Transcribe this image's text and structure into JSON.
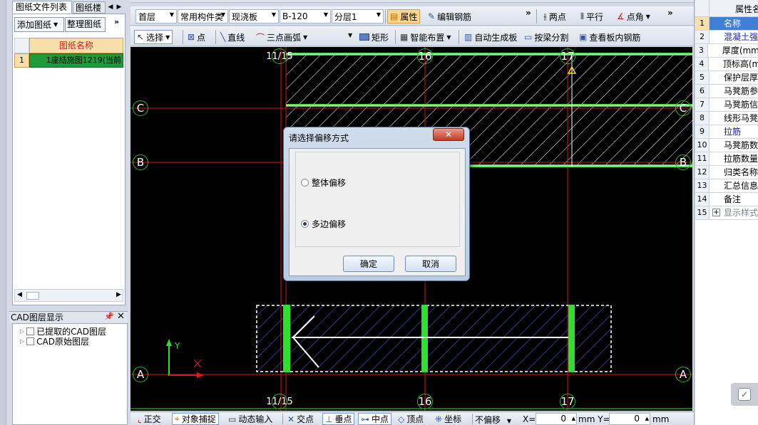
{
  "left_panel": {
    "tabs": [
      "图纸文件列表",
      "图纸楼"
    ],
    "buttons": {
      "add": "添加图纸",
      "organize": "整理图纸"
    },
    "column_header": "图纸名称",
    "rows": [
      {
        "num": "1",
        "name": "1座结施图1219(当前"
      }
    ]
  },
  "cad_layers": {
    "title": "CAD图层显示",
    "items": [
      "已提取的CAD图层",
      "CAD原始图层"
    ]
  },
  "toolbar1": {
    "floor": "首层",
    "component_type": "常用构件类",
    "slab_type": "现浇板",
    "component": "B-120",
    "layer": "分层1",
    "property_label": "属性",
    "edit_rebar_label": "编辑钢筋",
    "two_points_label": "两点",
    "parallel_label": "平行",
    "point_angle_label": "点角"
  },
  "toolbar2": {
    "select_label": "选择",
    "point_label": "点",
    "line_label": "直线",
    "arc_label": "三点画弧",
    "rect_label": "矩形",
    "smart_layout_label": "智能布置",
    "auto_slab_label": "自动生成板",
    "split_by_beam_label": "按梁分割",
    "view_rebar_label": "查看板内钢筋"
  },
  "canvas": {
    "grid_labels_top": [
      "11/15",
      "16",
      "17"
    ],
    "grid_labels_bottom": [
      "11/15",
      "16",
      "17"
    ],
    "row_labels": [
      "C",
      "B",
      "A"
    ],
    "axis_y": "Y",
    "axis_x": "X"
  },
  "dialog": {
    "title": "请选择偏移方式",
    "option_whole": "整体偏移",
    "option_multi": "多边偏移",
    "selected": "多边偏移",
    "ok": "确定",
    "cancel": "取消"
  },
  "properties": {
    "header": "属性名",
    "rows": [
      {
        "num": "1",
        "label": "名称",
        "color": "#1a1aa0",
        "selected": true
      },
      {
        "num": "2",
        "label": "混凝土强",
        "color": "#1a1aa0"
      },
      {
        "num": "3",
        "label": "厚度(mm)",
        "color": "#000000"
      },
      {
        "num": "4",
        "label": "顶标高(m",
        "color": "#000000"
      },
      {
        "num": "5",
        "label": "保护层厚",
        "color": "#000000"
      },
      {
        "num": "6",
        "label": "马凳筋参",
        "color": "#000000"
      },
      {
        "num": "7",
        "label": "马凳筋信",
        "color": "#000000"
      },
      {
        "num": "8",
        "label": "线形马凳",
        "color": "#000000"
      },
      {
        "num": "9",
        "label": "拉筋",
        "color": "#1a1aa0"
      },
      {
        "num": "10",
        "label": "马凳筋数",
        "color": "#000000"
      },
      {
        "num": "11",
        "label": "拉筋数量",
        "color": "#000000"
      },
      {
        "num": "12",
        "label": "归类名称",
        "color": "#000000"
      },
      {
        "num": "13",
        "label": "汇总信息",
        "color": "#000000"
      },
      {
        "num": "14",
        "label": "备注",
        "color": "#000000"
      },
      {
        "num": "15",
        "label": "显示样式",
        "color": "#000000"
      }
    ]
  },
  "statusbar": {
    "ortho": "正交",
    "snap": "对象捕捉",
    "dynamic_input": "动态输入",
    "intersection": "交点",
    "perpendicular": "垂点",
    "midpoint": "中点",
    "vertex": "顶点",
    "coordinate": "坐标",
    "offset_mode": "不偏移",
    "x_label": "X=",
    "x_value": "0",
    "y_label": "mm Y=",
    "y_value": "0",
    "unit": "mm"
  }
}
